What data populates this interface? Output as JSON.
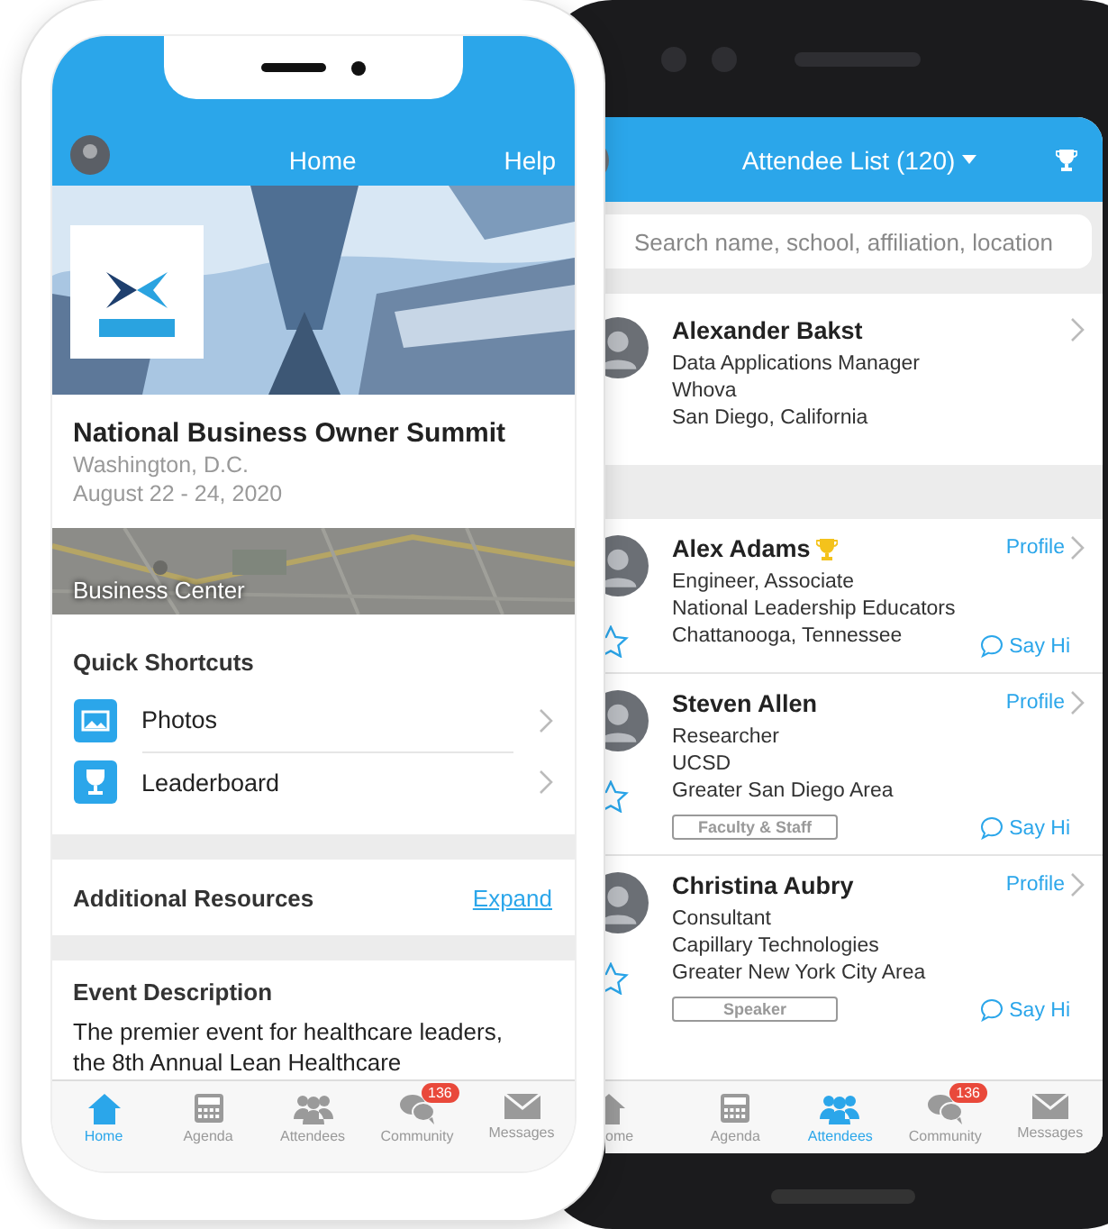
{
  "event_app": {
    "header": {
      "title": "Home",
      "action": "Help"
    },
    "event": {
      "name": "National Business Owner Summit",
      "location": "Washington, D.C.",
      "dates": "August 22 - 24, 2020"
    },
    "map": {
      "label": "Business Center"
    },
    "quick_shortcuts": {
      "title": "Quick Shortcuts",
      "items": [
        {
          "label": "Photos",
          "kind": "photos"
        },
        {
          "label": "Leaderboard",
          "kind": "trophy"
        }
      ]
    },
    "additional_resources": {
      "title": "Additional Resources",
      "action": "Expand"
    },
    "event_description": {
      "title": "Event Description",
      "lines": [
        "The premier event for healthcare leaders,",
        "the 8th Annual Lean Healthcare"
      ]
    },
    "tabs": [
      {
        "label": "Home",
        "kind": "home",
        "selected": true
      },
      {
        "label": "Agenda",
        "kind": "agenda",
        "selected": false
      },
      {
        "label": "Attendees",
        "kind": "attendees",
        "selected": false
      },
      {
        "label": "Community",
        "kind": "community",
        "selected": false,
        "badge": "136"
      },
      {
        "label": "Messages",
        "kind": "messages",
        "selected": false
      }
    ]
  },
  "attendee_app": {
    "header": {
      "title": "Attendee List (120)"
    },
    "search": {
      "placeholder": "Search name, school, affiliation, location"
    },
    "featured": {
      "name": "Alexander Bakst",
      "lines": [
        "Data Applications Manager",
        "Whova",
        "San Diego, California"
      ]
    },
    "attendees": [
      {
        "name": "Alex Adams",
        "trophy": true,
        "lines": [
          "Engineer, Associate",
          "National Leadership Educators",
          "Chattanooga, Tennessee"
        ],
        "profile": "Profile",
        "say_hi": "Say Hi"
      },
      {
        "name": "Steven Allen",
        "trophy": false,
        "lines": [
          "Researcher",
          "UCSD",
          "Greater San Diego Area"
        ],
        "tag": "Faculty & Staff",
        "profile": "Profile",
        "say_hi": "Say Hi"
      },
      {
        "name": "Christina Aubry",
        "trophy": false,
        "lines": [
          "Consultant",
          "Capillary Technologies",
          "Greater New York City Area"
        ],
        "tag": "Speaker",
        "profile": "Profile",
        "say_hi": "Say Hi"
      }
    ],
    "tabs": [
      {
        "label": "ome",
        "kind": "home",
        "selected": false
      },
      {
        "label": "Agenda",
        "kind": "agenda",
        "selected": false
      },
      {
        "label": "Attendees",
        "kind": "attendees",
        "selected": true
      },
      {
        "label": "Community",
        "kind": "community",
        "selected": false,
        "badge": "136"
      },
      {
        "label": "Messages",
        "kind": "messages",
        "selected": false
      }
    ]
  }
}
